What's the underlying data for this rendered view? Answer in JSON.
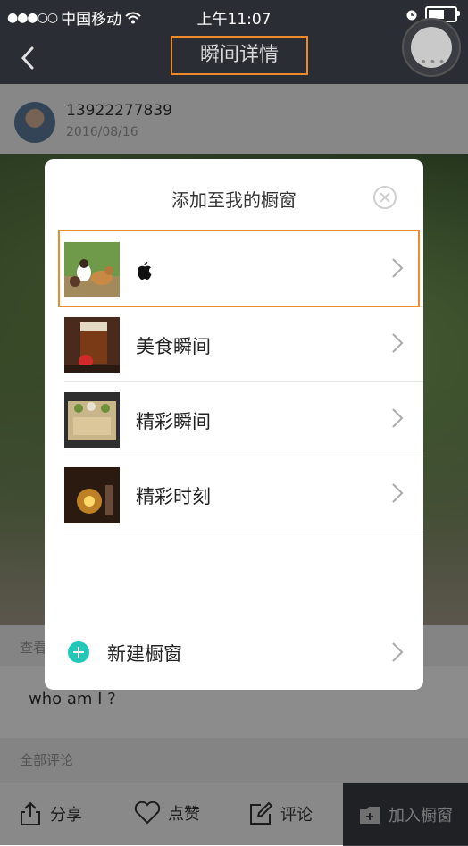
{
  "status_bar": {
    "carrier": "中国移动",
    "time": "上午11:07",
    "battery_level": 0.6
  },
  "nav": {
    "title": "瞬间详情"
  },
  "post": {
    "author_phone": "13922277839",
    "date": "2016/08/16",
    "view_label": "查看",
    "caption": "who am I ?",
    "comments_label": "全部评论"
  },
  "bottom_bar": {
    "share": "分享",
    "like": "点赞",
    "comment": "评论",
    "add_showcase": "加入橱窗"
  },
  "modal": {
    "title": "添加至我的橱窗",
    "items": [
      {
        "label": "",
        "icon": "apple-icon"
      },
      {
        "label": "美食瞬间"
      },
      {
        "label": "精彩瞬间"
      },
      {
        "label": "精彩时刻"
      }
    ],
    "new_label": "新建橱窗"
  }
}
